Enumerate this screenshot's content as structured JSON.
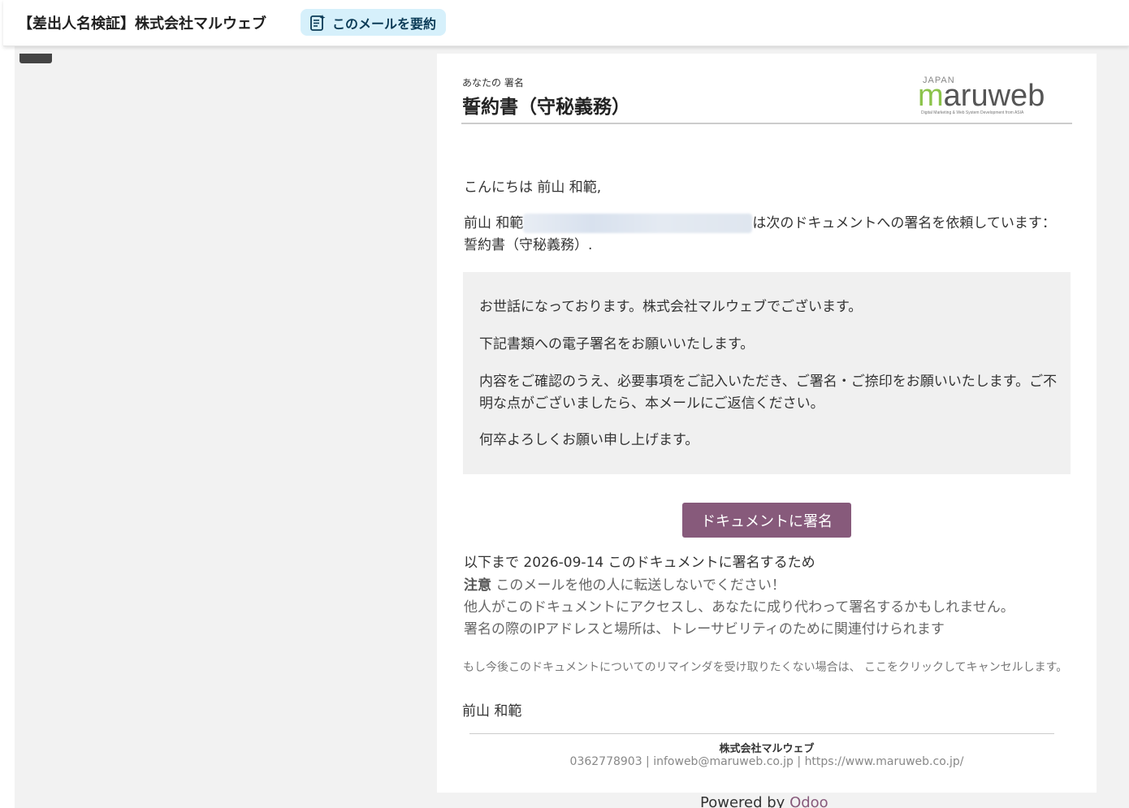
{
  "header": {
    "subject": "【差出人名検証】株式会社マルウェブ",
    "summarize_label": "このメールを要約",
    "summarize_icon": "summarize-icon"
  },
  "email": {
    "your_signature_label": "あなたの 署名",
    "document_title": "誓約書（守秘義務）",
    "logo": {
      "top_text": "JAPAN",
      "brand": "maruweb",
      "tagline": "Digital Marketing & Web System Development from ASIA"
    },
    "greeting": "こんにちは 前山 和範,",
    "request_sender": "前山 和範",
    "request_text": "は次のドキュメントへの署名を依頼しています： 誓約書（守秘義務）.",
    "message_lines": [
      "お世話になっております。株式会社マルウェブでございます。",
      "下記書類への電子署名をお願いいたします。",
      "内容をご確認のうえ、必要事項をご記入いただき、ご署名・ご捺印をお願いいたします。ご不明な点がございましたら、本メールにご返信ください。",
      "何卒よろしくお願い申し上げます。"
    ],
    "sign_button": "ドキュメントに署名",
    "deadline_prefix": "以下まで",
    "deadline_date": "2026-09-14",
    "deadline_suffix": "このドキュメントに署名するため",
    "note_label": "注意",
    "note_text": "このメールを他の人に転送しないでください！",
    "warning_1": "他人がこのドキュメントにアクセスし、あなたに成り代わって署名するかもしれません。",
    "warning_2": "署名の際のIPアドレスと場所は、トレーサビリティのために関連付けられます",
    "cancel_reminder": "もし今後このドキュメントについてのリマインダを受け取りたくない場合は、 ここをクリックしてキャンセルします。",
    "signer_name": "前山 和範",
    "footer": {
      "company": "株式会社マルウェブ",
      "phone": "0362778903",
      "email": "infoweb@maruweb.co.jp",
      "website": "https://www.maruweb.co.jp/",
      "separator": " | "
    }
  },
  "powered_by": {
    "prefix": "Powered by",
    "brand": "Odoo"
  },
  "colors": {
    "odoo_purple": "#875a7b",
    "summarize_bg": "#d6f0fb",
    "logo_green": "#8bc34a",
    "logo_gray": "#555555"
  }
}
